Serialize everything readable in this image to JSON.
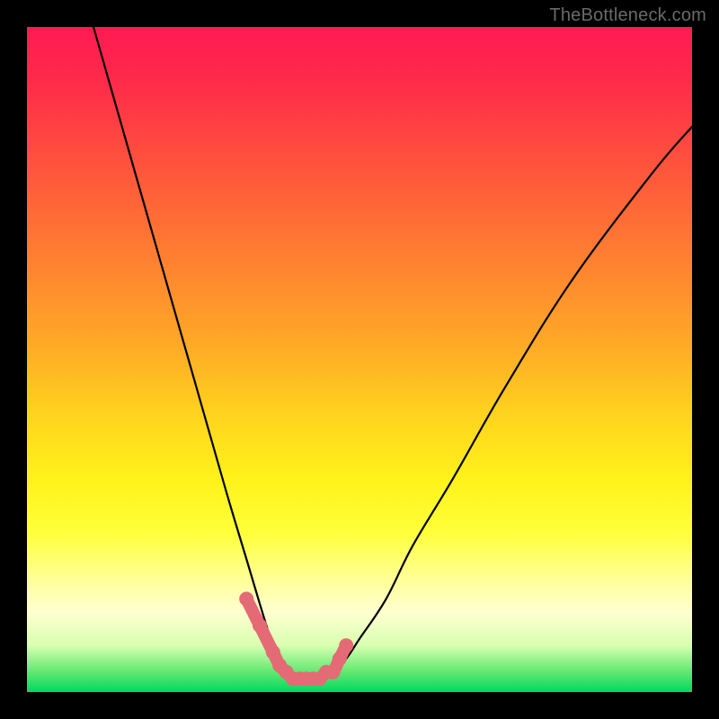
{
  "watermark": "TheBottleneck.com",
  "colors": {
    "background_frame": "#000000",
    "gradient_top": "#ff1a52",
    "gradient_mid": "#ffff3a",
    "gradient_bottom": "#00d860",
    "curve": "#000000",
    "highlight": "#e46a75"
  },
  "chart_data": {
    "type": "line",
    "title": "",
    "xlabel": "",
    "ylabel": "",
    "xlim": [
      0,
      100
    ],
    "ylim": [
      0,
      100
    ],
    "grid": false,
    "legend": false,
    "description": "Bottleneck-style V curve on a red-to-green vertical gradient. Left branch descends steeply from top-left, reaches a flat minimum around x≈38-46 near y≈2, then right branch rises toward upper right. Pink segment highlights the flat bottom.",
    "series": [
      {
        "name": "curve",
        "x": [
          10,
          14,
          18,
          22,
          26,
          30,
          33,
          36,
          38,
          40,
          42,
          44,
          46,
          48,
          50,
          54,
          58,
          64,
          72,
          82,
          94,
          100
        ],
        "y": [
          100,
          86,
          72,
          58,
          44,
          30,
          20,
          10,
          4,
          2,
          2,
          2,
          3,
          5,
          8,
          14,
          22,
          32,
          46,
          62,
          78,
          85
        ]
      },
      {
        "name": "highlight_bottom",
        "x": [
          33,
          35,
          37,
          38,
          39,
          40,
          41,
          42,
          43,
          44,
          45,
          46,
          47,
          48
        ],
        "y": [
          14,
          10,
          6,
          4,
          3,
          2,
          2,
          2,
          2,
          2,
          3,
          3,
          5,
          7
        ]
      }
    ]
  }
}
